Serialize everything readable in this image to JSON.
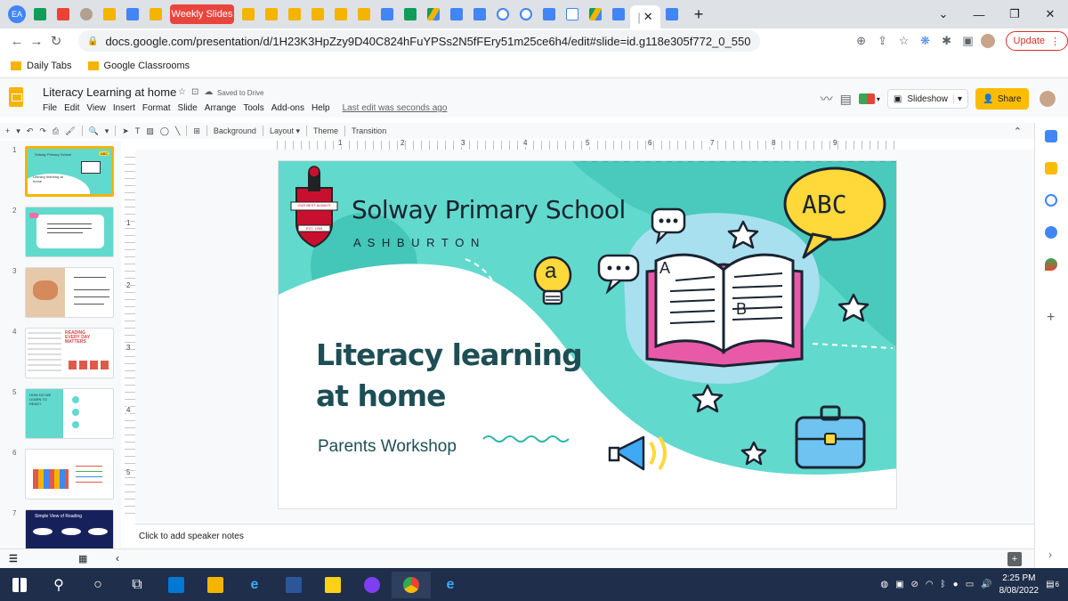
{
  "browser": {
    "profile_badge": "EA",
    "active_tab_title": "Weekly Slides",
    "url": "docs.google.com/presentation/d/1H23K3HpZzy9D40C824hFuYPSs2N5fFEry51m25ce6h4/edit#slide=id.g118e305f772_0_550",
    "update_label": "Update",
    "bookmarks": [
      "Daily Tabs",
      "Google Classrooms"
    ]
  },
  "app": {
    "doc_title": "Literacy Learning at home",
    "saved_status": "Saved to Drive",
    "menu": [
      "File",
      "Edit",
      "View",
      "Insert",
      "Format",
      "Slide",
      "Arrange",
      "Tools",
      "Add-ons",
      "Help"
    ],
    "last_edit": "Last edit was seconds ago",
    "slideshow_label": "Slideshow",
    "share_label": "Share"
  },
  "toolbar": {
    "background_label": "Background",
    "layout_label": "Layout",
    "theme_label": "Theme",
    "transition_label": "Transition"
  },
  "ruler": {
    "h_numbers": [
      "1",
      "2",
      "3",
      "4",
      "5",
      "6",
      "7",
      "8",
      "9"
    ],
    "v_numbers": [
      "1",
      "2",
      "3",
      "4",
      "5"
    ]
  },
  "thumbnails": [
    {
      "num": "1",
      "selected": true
    },
    {
      "num": "2",
      "selected": false
    },
    {
      "num": "3",
      "selected": false
    },
    {
      "num": "4",
      "selected": false
    },
    {
      "num": "5",
      "selected": false
    },
    {
      "num": "6",
      "selected": false
    },
    {
      "num": "7",
      "selected": false
    }
  ],
  "thumb_texts": {
    "t1_school": "Solway Primary School",
    "t1_title": "Literacy learning at home",
    "t1_badge": "ABC",
    "t4_heading": "READING EVERY DAY MATTERS",
    "t5_heading": "HOW DO WE LEARN TO READ?",
    "t7_heading": "Simple View of Reading"
  },
  "slide": {
    "school_name": "Solway Primary School",
    "suburb": "A S H B U R T O N",
    "crest_motto": "OUR BEST ALWAYS",
    "crest_est": "EST. 1955",
    "title_line1": "Literacy learning",
    "title_line2": "at home",
    "subtitle": "Parents Workshop",
    "speech_bubble": "ABC",
    "bulb_letter": "a",
    "book_letter_a": "A",
    "book_letter_b": "B"
  },
  "notes": {
    "placeholder": "Click to add speaker notes"
  },
  "taskbar": {
    "time": "2:25 PM",
    "date": "8/08/2022",
    "notif_count": "6"
  },
  "colors": {
    "slide_teal": "#62d9cd",
    "slide_teal_dark": "#2cb7a9",
    "share_yellow": "#fbbc04",
    "title_teal": "#1e4e55",
    "crest_red": "#c8102e",
    "bubble_yellow": "#ffd83a"
  }
}
